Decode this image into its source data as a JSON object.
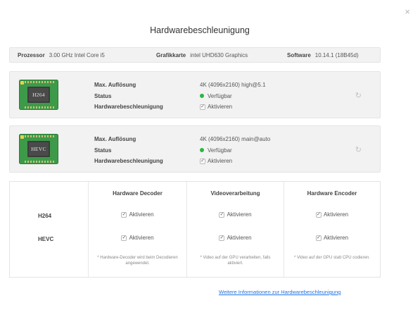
{
  "dialog": {
    "title": "Hardwarebeschleunigung",
    "close_glyph": "×"
  },
  "system": {
    "processor_label": "Prozessor",
    "processor_value": "3.00 GHz Intel Core i5",
    "graphics_label": "Grafikkarte",
    "graphics_value": "intel UHD630 Graphics",
    "software_label": "Software",
    "software_value": "10.14.1 (18B45d)"
  },
  "codecs": [
    {
      "chip": "H264",
      "max_res_label": "Max. Auflösung",
      "max_res_value": "4K (4096x2160) high@5.1",
      "status_label": "Status",
      "status_value": "Verfügbar",
      "hw_label": "Hardwarebeschleunigung",
      "hw_value": "Aktivieren"
    },
    {
      "chip": "HEVC",
      "max_res_label": "Max. Auflösung",
      "max_res_value": "4K (4096x2160) main@auto",
      "status_label": "Status",
      "status_value": "Verfügbar",
      "hw_label": "Hardwarebeschleunigung",
      "hw_value": "Aktivieren"
    }
  ],
  "matrix": {
    "rows": [
      "H264",
      "HEVC"
    ],
    "columns": [
      {
        "header": "Hardware Decoder",
        "checkbox_label": "Aktivieren",
        "note": "* Hardware-Decoder wird beim Decodieren angewendet."
      },
      {
        "header": "Videoverarbeitung",
        "checkbox_label": "Aktivieren",
        "note": "* Video auf der GPU verarbeiten, falls aktiviert."
      },
      {
        "header": "Hardware Encoder",
        "checkbox_label": "Aktivieren",
        "note": "* Video auf der GPU statt CPU codieren."
      }
    ]
  },
  "footer": {
    "link": "Weitere Informationen zur Hardwarebeschleunigung"
  },
  "colors": {
    "chip_green": "#3d9a48",
    "status_green": "#2bb640",
    "link_blue": "#1e73e6"
  },
  "icons": {
    "close": "close-icon",
    "refresh": "refresh-icon",
    "checkbox": "check-icon",
    "chip": "chip-icon"
  }
}
